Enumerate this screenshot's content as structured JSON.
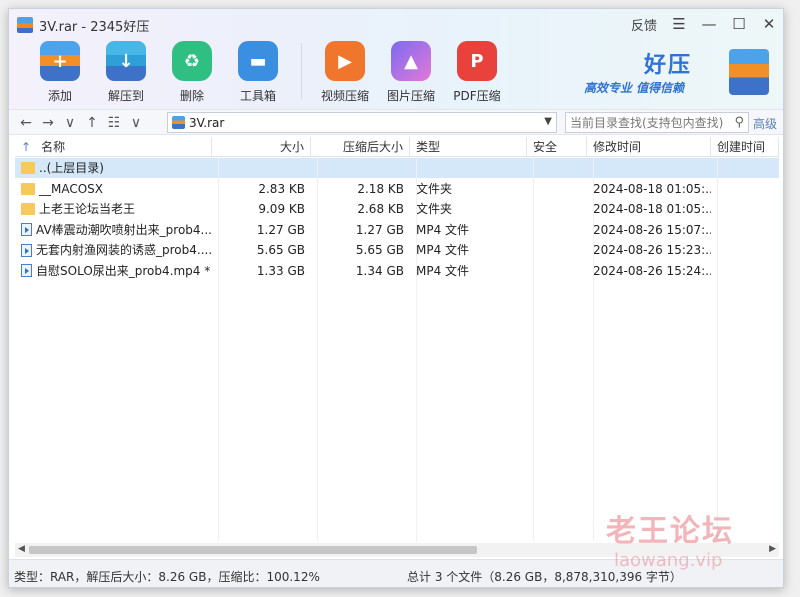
{
  "window": {
    "title": "3V.rar - 2345好压",
    "feedback": "反馈",
    "menu_glyph": "☰",
    "min_glyph": "—",
    "max_glyph": "☐",
    "close_glyph": "✕"
  },
  "toolbar": [
    {
      "name": "add",
      "label": "添加",
      "glyph": "+"
    },
    {
      "name": "extract",
      "label": "解压到",
      "glyph": "↓"
    },
    {
      "name": "delete",
      "label": "删除",
      "glyph": "♻"
    },
    {
      "name": "tools",
      "label": "工具箱",
      "glyph": "▬"
    },
    {
      "name": "video",
      "label": "视频压缩",
      "glyph": "▶"
    },
    {
      "name": "image",
      "label": "图片压缩",
      "glyph": "▲"
    },
    {
      "name": "pdf",
      "label": "PDF压缩",
      "glyph": "P"
    }
  ],
  "brand": {
    "name": "好压",
    "slogan": "高效专业  值得信赖"
  },
  "address": {
    "back": "←",
    "forward": "→",
    "down": "∨",
    "up": "↑",
    "view": "☷",
    "view_dd": "∨",
    "path": "3V.rar",
    "search_placeholder": "当前目录查找(支持包内查找)",
    "advanced": "高级"
  },
  "columns": [
    "名称",
    "大小",
    "压缩后大小",
    "类型",
    "安全",
    "修改时间",
    "创建时间"
  ],
  "sort_arrow": "↑",
  "rows": [
    {
      "icon": "folder",
      "name": "..(上层目录)",
      "size": "",
      "packed": "",
      "type": "",
      "security": "",
      "modified": "",
      "created": "",
      "selected": true
    },
    {
      "icon": "folder",
      "name": "__MACOSX",
      "size": "2.83 KB",
      "packed": "2.18 KB",
      "type": "文件夹",
      "security": "",
      "modified": "2024-08-18 01:05:...",
      "created": ""
    },
    {
      "icon": "folder",
      "name": "上老王论坛当老王",
      "size": "9.09 KB",
      "packed": "2.68 KB",
      "type": "文件夹",
      "security": "",
      "modified": "2024-08-18 01:05:...",
      "created": ""
    },
    {
      "icon": "video",
      "name": "AV棒震动潮吹喷射出来_prob4...",
      "size": "1.27 GB",
      "packed": "1.27 GB",
      "type": "MP4 文件",
      "security": "",
      "modified": "2024-08-26 15:07:...",
      "created": ""
    },
    {
      "icon": "video",
      "name": "无套内射渔网装的诱惑_prob4....",
      "size": "5.65 GB",
      "packed": "5.65 GB",
      "type": "MP4 文件",
      "security": "",
      "modified": "2024-08-26 15:23:...",
      "created": ""
    },
    {
      "icon": "video",
      "name": "自慰SOLO尿出来_prob4.mp4 *",
      "size": "1.33 GB",
      "packed": "1.34 GB",
      "type": "MP4 文件",
      "security": "",
      "modified": "2024-08-26 15:24:...",
      "created": ""
    }
  ],
  "scrollbar": {
    "left": "◀",
    "right": "▶"
  },
  "status": {
    "left": "类型：RAR，解压后大小：8.26 GB，压缩比：100.12%",
    "right": "总计 3 个文件（8.26 GB，8,878,310,396 字节）"
  },
  "watermark": {
    "line1": "老王论坛",
    "line2": "laowang.vip"
  }
}
